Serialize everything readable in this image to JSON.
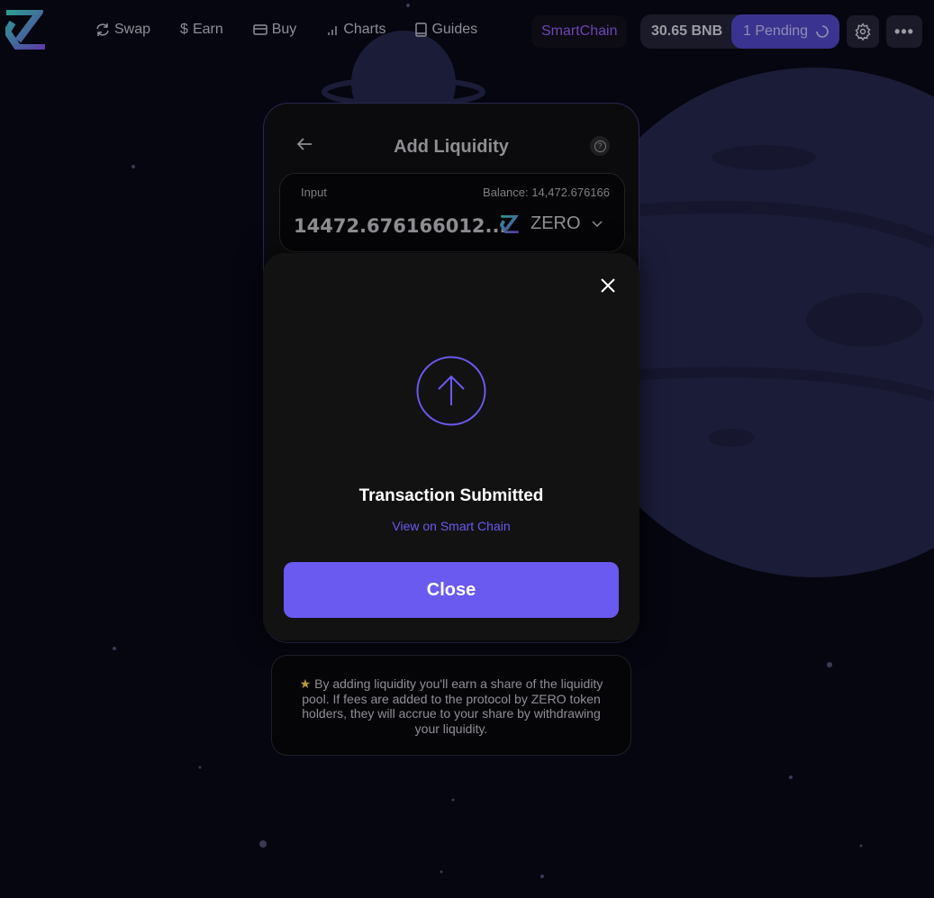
{
  "nav": {
    "items": [
      {
        "label": "Swap",
        "icon": "refresh-icon"
      },
      {
        "label": "Earn",
        "icon": "dollar-icon"
      },
      {
        "label": "Buy",
        "icon": "card-icon"
      },
      {
        "label": "Charts",
        "icon": "bar-chart-icon"
      },
      {
        "label": "Guides",
        "icon": "book-icon"
      }
    ]
  },
  "network": "SmartChain",
  "wallet": {
    "balance": "30.65 BNB",
    "pending": "1 Pending"
  },
  "card": {
    "title": "Add Liquidity",
    "input_label": "Input",
    "balance": "Balance: 14,472.676166",
    "amount": "14472.676166012...",
    "token": "ZERO"
  },
  "modal": {
    "title": "Transaction Submitted",
    "link": "View on Smart Chain",
    "close": "Close"
  },
  "info": {
    "star": "★",
    "text": "By adding liquidity you'll earn a share of the liquidity pool. If fees are added to the protocol by ZERO token holders, they will accrue to your share by withdrawing your liquidity."
  },
  "colors": {
    "accent": "#6a5af0",
    "pending": "#3b3390",
    "network": "#6b45b5",
    "background": "#05060f"
  }
}
